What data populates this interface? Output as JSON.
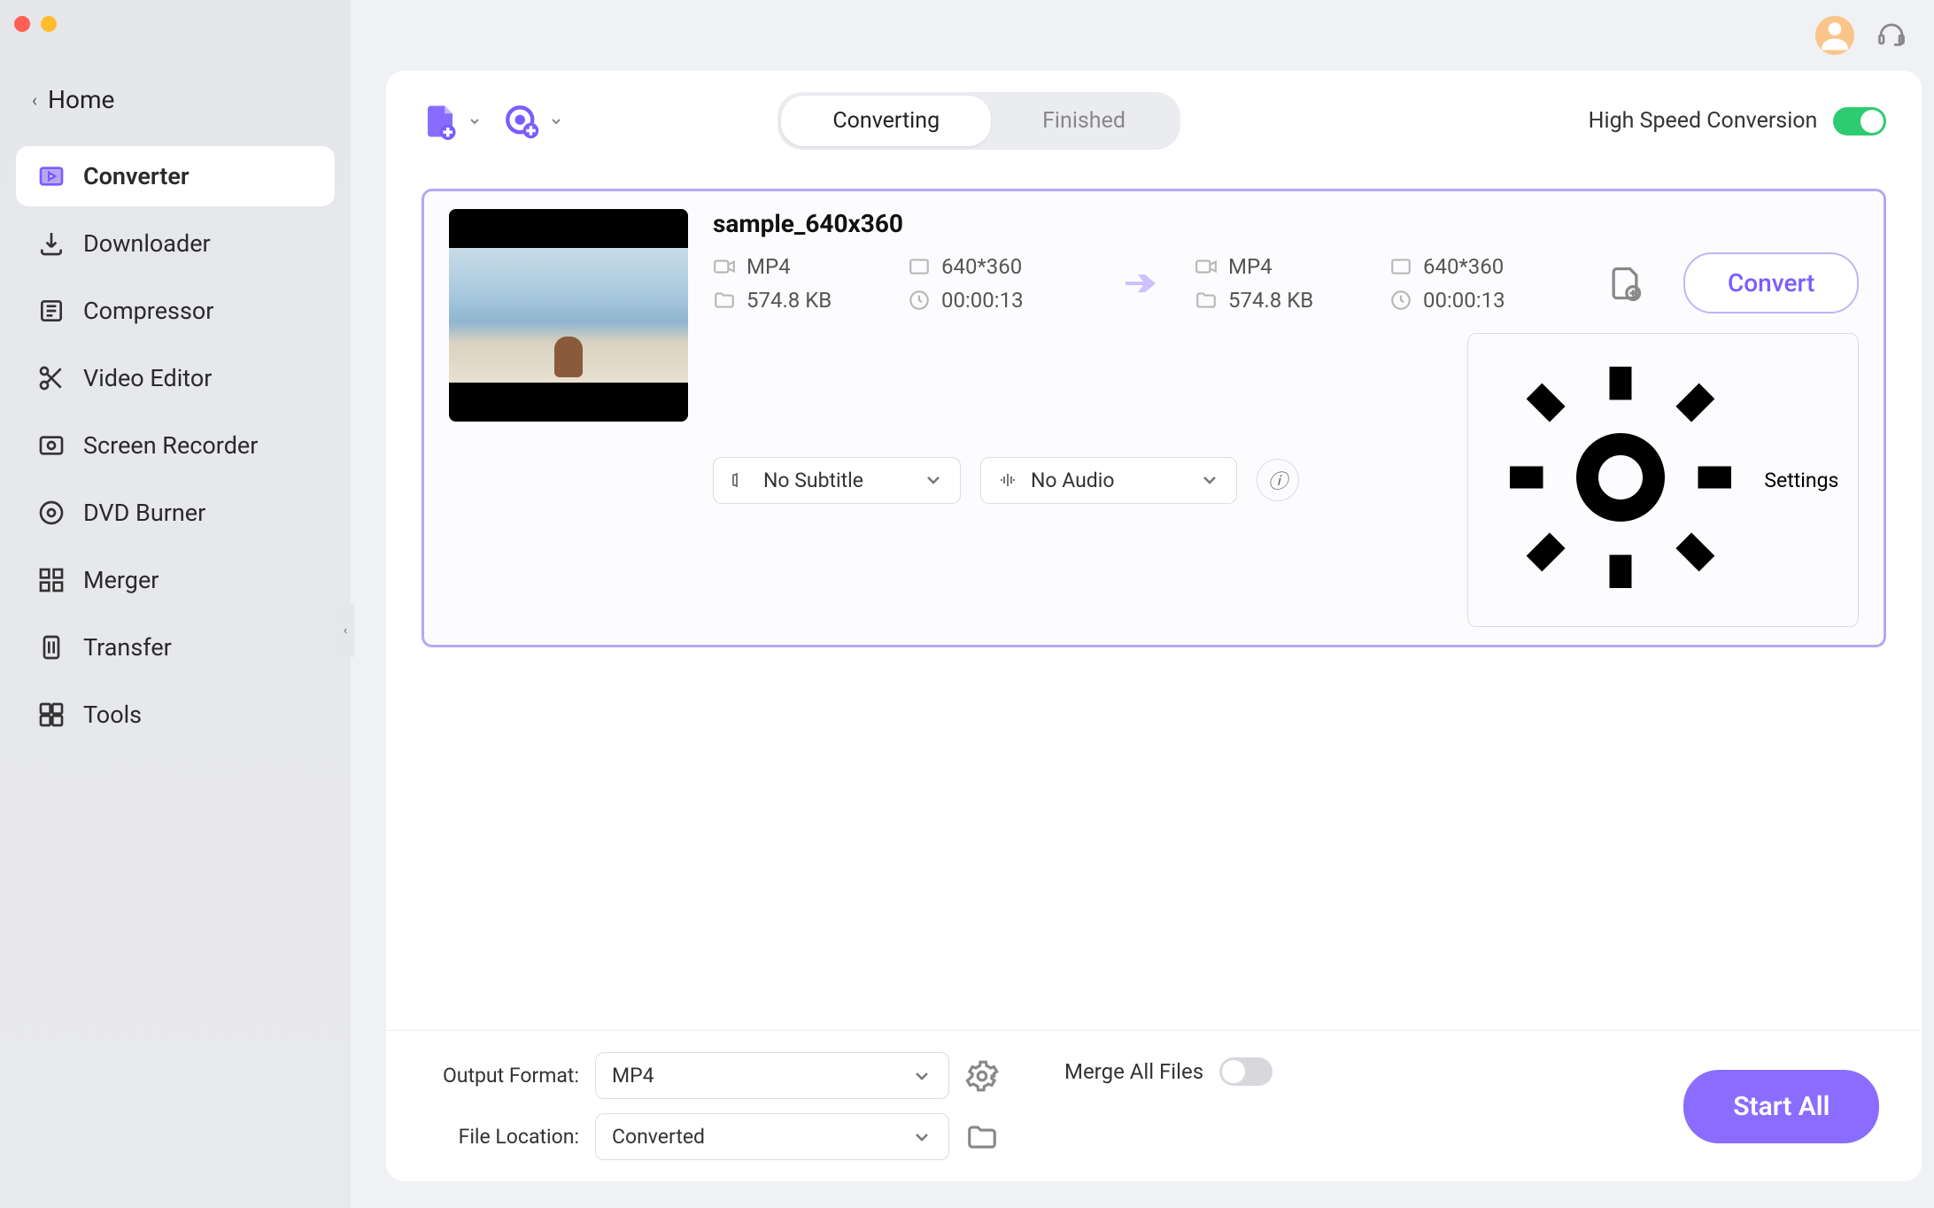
{
  "sidebar": {
    "home": "Home",
    "items": [
      {
        "label": "Converter"
      },
      {
        "label": "Downloader"
      },
      {
        "label": "Compressor"
      },
      {
        "label": "Video Editor"
      },
      {
        "label": "Screen Recorder"
      },
      {
        "label": "DVD Burner"
      },
      {
        "label": "Merger"
      },
      {
        "label": "Transfer"
      },
      {
        "label": "Tools"
      }
    ]
  },
  "tabs": {
    "converting": "Converting",
    "finished": "Finished"
  },
  "high_speed_label": "High Speed Conversion",
  "file": {
    "name": "sample_640x360",
    "source": {
      "format": "MP4",
      "resolution": "640*360",
      "size": "574.8 KB",
      "duration": "00:00:13"
    },
    "target": {
      "format": "MP4",
      "resolution": "640*360",
      "size": "574.8 KB",
      "duration": "00:00:13"
    },
    "subtitle": "No Subtitle",
    "audio": "No Audio",
    "settings_label": "Settings",
    "convert_label": "Convert"
  },
  "bottom": {
    "output_format_label": "Output Format:",
    "output_format_value": "MP4",
    "file_location_label": "File Location:",
    "file_location_value": "Converted",
    "merge_label": "Merge All Files",
    "start_label": "Start All"
  }
}
